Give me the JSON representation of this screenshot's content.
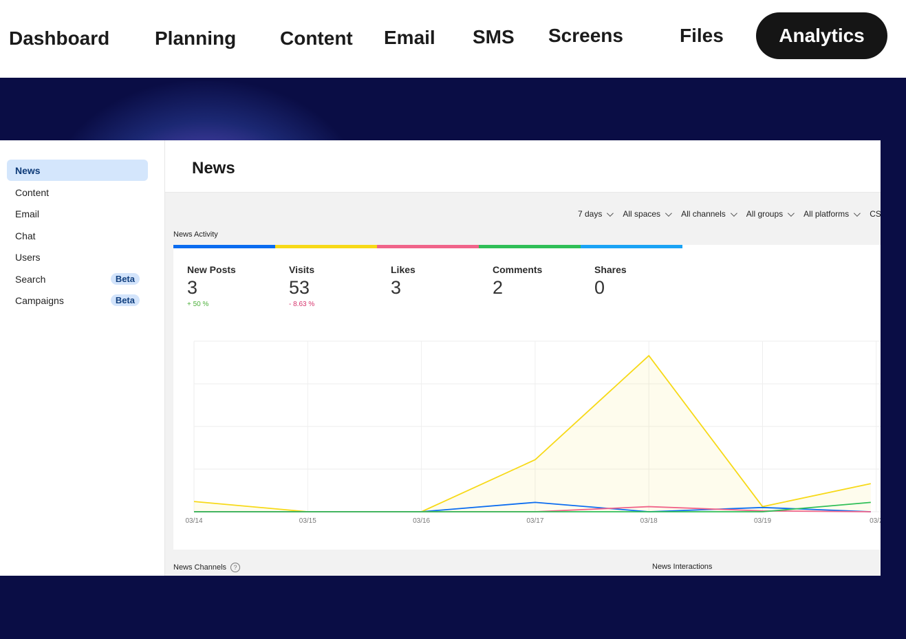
{
  "nav": {
    "tabs": [
      {
        "label": "Dashboard"
      },
      {
        "label": "Planning"
      },
      {
        "label": "Content"
      },
      {
        "label": "Email"
      },
      {
        "label": "SMS"
      },
      {
        "label": "Screens"
      },
      {
        "label": "Files"
      },
      {
        "label": "Analytics",
        "active": true
      }
    ]
  },
  "sidebar": {
    "items": [
      {
        "label": "News",
        "active": true
      },
      {
        "label": "Content"
      },
      {
        "label": "Email"
      },
      {
        "label": "Chat"
      },
      {
        "label": "Users"
      },
      {
        "label": "Search",
        "badge": "Beta"
      },
      {
        "label": "Campaigns",
        "badge": "Beta"
      }
    ]
  },
  "page": {
    "title": "News"
  },
  "filters": {
    "range": "7 days",
    "spaces": "All spaces",
    "channels": "All channels",
    "groups": "All groups",
    "platforms": "All platforms",
    "csv": "CSV e"
  },
  "activity": {
    "label": "News Activity",
    "stats": [
      {
        "label": "New Posts",
        "value": "3",
        "delta": "+ 50 %",
        "delta_color": "#4caf3a",
        "color": "#0a6cf0"
      },
      {
        "label": "Visits",
        "value": "53",
        "delta": "- 8.63 %",
        "delta_color": "#d6336c",
        "color": "#f7d917"
      },
      {
        "label": "Likes",
        "value": "3",
        "color": "#f0648a"
      },
      {
        "label": "Comments",
        "value": "2",
        "color": "#2fbf57"
      },
      {
        "label": "Shares",
        "value": "0",
        "color": "#1aa3f5"
      }
    ]
  },
  "bottom": {
    "channels_label": "News Channels",
    "interactions_label": "News Interactions"
  },
  "chart_data": {
    "type": "line",
    "x": [
      "03/14",
      "03/15",
      "03/16",
      "03/17",
      "03/18",
      "03/19",
      "03/2"
    ],
    "ylim": [
      0,
      20
    ],
    "series": [
      {
        "name": "Visits",
        "color": "#f7d917",
        "fill": true,
        "values": [
          1.2,
          0,
          0,
          6.1,
          18.3,
          0.6,
          3.3
        ]
      },
      {
        "name": "New Posts",
        "color": "#0a6cf0",
        "values": [
          0,
          0,
          0,
          1.1,
          0,
          0.5,
          0
        ]
      },
      {
        "name": "Likes",
        "color": "#f0648a",
        "values": [
          0,
          0,
          0,
          0,
          0.6,
          0.1,
          0
        ]
      },
      {
        "name": "Comments",
        "color": "#2fbf57",
        "values": [
          0,
          0,
          0,
          0,
          0,
          0,
          1.1
        ]
      }
    ]
  }
}
